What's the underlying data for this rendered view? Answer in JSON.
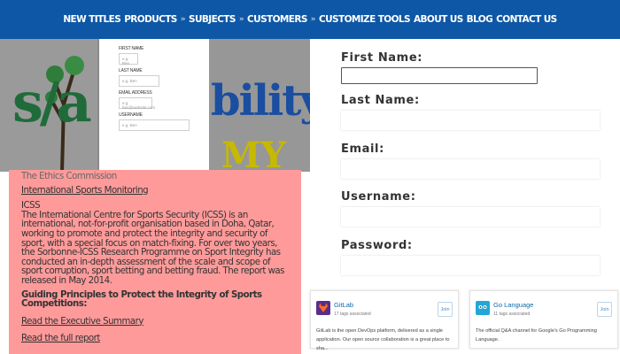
{
  "nav": {
    "items": [
      "NEW TITLES",
      "PRODUCTS",
      "SUBJECTS",
      "CUSTOMERS",
      "CUSTOMIZE TOOLS",
      "ABOUT US",
      "BLOG",
      "CONTACT US"
    ]
  },
  "banner": {
    "left_text": "s/a",
    "right_text": "bility",
    "bottom_text": "MY"
  },
  "mini_form": {
    "fields": [
      {
        "label": "First Name",
        "placeholder": "e.g. Ben"
      },
      {
        "label": "Last Name",
        "placeholder": "e.g. Ben"
      },
      {
        "label": "Email Address",
        "placeholder": "e.g. ben@website.com"
      },
      {
        "label": "Username",
        "placeholder": "e.g. Ben"
      }
    ]
  },
  "article": {
    "ethics": "The Ethics Commission",
    "ism": "International Sports Monitoring",
    "icss_heading": "ICSS",
    "body": "The International Centre for Sports Security (ICSS) is an international, not-for-profit organisation based in Doha, Qatar, working to promote and protect the integrity and security of sport, with a special focus on match-fixing. For over two years, the Sorbonne-ICSS Research Programme on Sport Integrity has conducted an in-depth assessment of the scale and scope of sport corruption, sport betting and betting fraud. The report was released in May 2014.",
    "principles": "Guiding Principles to Protect the Integrity of Sports Competitions:",
    "exec_link": "Read the Executive Summary",
    "full_link": "Read the full report"
  },
  "signup": {
    "first_name": "First Name:",
    "last_name": "Last Name:",
    "email": "Email:",
    "username": "Username:",
    "password": "Password:"
  },
  "cards": [
    {
      "title": "GitLab",
      "sub": "17 tags associated",
      "join": "Join",
      "desc": "GitLab is the open DevOps platform, delivered as a single application. Our open source collaboration is a great place to sha..."
    },
    {
      "title": "Go Language",
      "sub": "11 tags associated",
      "join": "Join",
      "desc": "The official Q&A channel for Google's Go Programming Language."
    }
  ]
}
